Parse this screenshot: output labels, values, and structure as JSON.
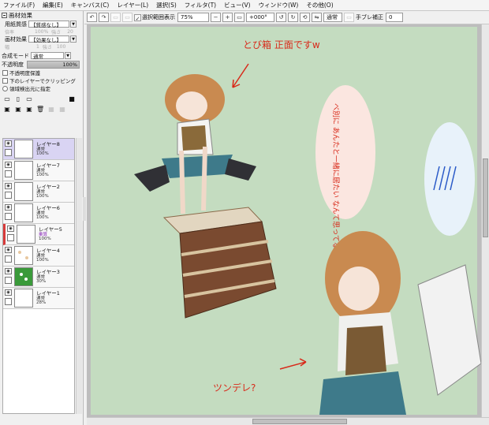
{
  "menu": [
    "ファイル(F)",
    "編集(E)",
    "キャンバス(C)",
    "レイヤー(L)",
    "選択(S)",
    "フィルタ(T)",
    "ビュー(V)",
    "ウィンドウ(W)",
    "その他(O)"
  ],
  "texture_panel": {
    "header": "画材効果",
    "paper_label": "用紙質感",
    "paper_value": "【質感なし】",
    "paper_scale_label": "倍率",
    "paper_scale": "100%",
    "paper_strength_label": "強さ",
    "paper_strength": "20",
    "effect_label": "画材効果",
    "effect_value": "【効果なし】",
    "effect_width_label": "幅",
    "effect_width": "1",
    "effect_strength_label": "強さ",
    "effect_strength": "100"
  },
  "blend": {
    "label": "合成モード",
    "value": "通常"
  },
  "opacity": {
    "label": "不透明度",
    "value": "100%"
  },
  "options": {
    "protect_alpha": "不透明度保護",
    "clip": "下のレイヤーでクリッピング",
    "selection_source": "領域検出元に指定"
  },
  "layers": [
    {
      "name": "レイヤー8",
      "mode": "通常",
      "opacity": "100%",
      "active": true
    },
    {
      "name": "レイヤー7",
      "mode": "通常",
      "opacity": "100%"
    },
    {
      "name": "レイヤー2",
      "mode": "通常",
      "opacity": "100%"
    },
    {
      "name": "レイヤー6",
      "mode": "通常",
      "opacity": "100%"
    },
    {
      "name": "レイヤー5",
      "mode": "乗算",
      "opacity": "100%",
      "mode_color": "#8b2fb8"
    },
    {
      "name": "レイヤー4",
      "mode": "通常",
      "opacity": "100%"
    },
    {
      "name": "レイヤー3",
      "mode": "通常",
      "opacity": "30%"
    },
    {
      "name": "レイヤー1",
      "mode": "通常",
      "opacity": "28%"
    }
  ],
  "toolbar": {
    "selection_display_label": "選択範囲表示",
    "zoom": "75%",
    "rotation": "+000°",
    "blend_mode": "通常",
    "stabilizer_label": "手ブレ補正",
    "stabilizer_value": "0"
  },
  "canvas": {
    "bg_color": "#c4dcc0",
    "annotation_top": "とび箱 正面ですw",
    "bubble_text": "べ別に あんたと一緒に居たい なんて思ってないよ",
    "annotation_bottom": "ツンデレ?"
  }
}
